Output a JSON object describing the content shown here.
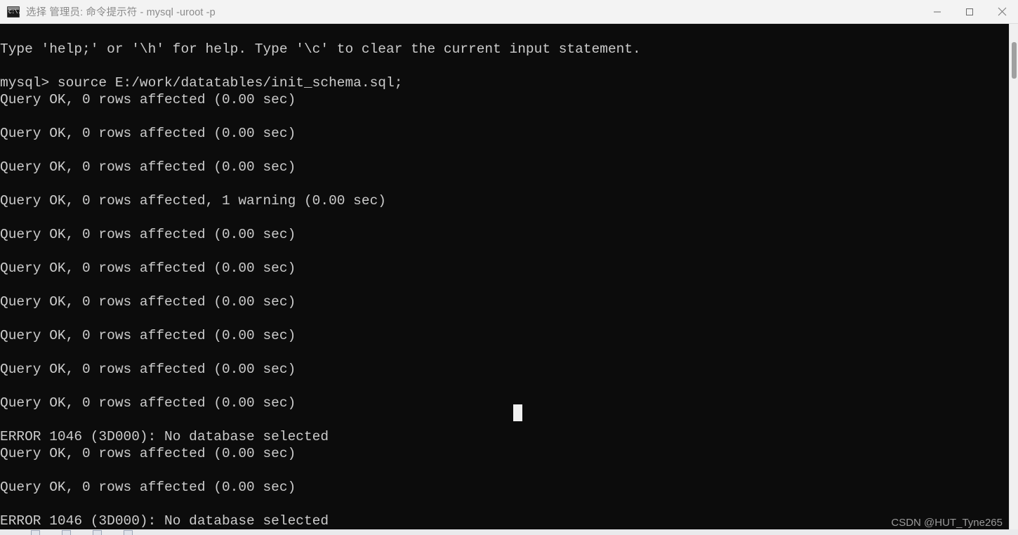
{
  "window": {
    "title": "选择 管理员: 命令提示符 - mysql  -uroot -p",
    "icon_label": "C:\\.",
    "icon_name": "command-prompt-icon",
    "colors": {
      "titlebar_bg": "#f3f3f3",
      "titlebar_text": "#8b8b8b",
      "terminal_bg": "#0c0c0c",
      "terminal_text": "#cccccc",
      "scrollbar_track": "#f0f0f0",
      "scrollbar_thumb": "#a0a0a0",
      "close_hover": "#e81123"
    },
    "controls": {
      "minimize": "—",
      "maximize": "□",
      "close": "✕"
    }
  },
  "terminal": {
    "lines": [
      "",
      "Type 'help;' or '\\h' for help. Type '\\c' to clear the current input statement.",
      "",
      "mysql> source E:/work/datatables/init_schema.sql;",
      "Query OK, 0 rows affected (0.00 sec)",
      "",
      "Query OK, 0 rows affected (0.00 sec)",
      "",
      "Query OK, 0 rows affected (0.00 sec)",
      "",
      "Query OK, 0 rows affected, 1 warning (0.00 sec)",
      "",
      "Query OK, 0 rows affected (0.00 sec)",
      "",
      "Query OK, 0 rows affected (0.00 sec)",
      "",
      "Query OK, 0 rows affected (0.00 sec)",
      "",
      "Query OK, 0 rows affected (0.00 sec)",
      "",
      "Query OK, 0 rows affected (0.00 sec)",
      "",
      "Query OK, 0 rows affected (0.00 sec)",
      "",
      "ERROR 1046 (3D000): No database selected",
      "Query OK, 0 rows affected (0.00 sec)",
      "",
      "Query OK, 0 rows affected (0.00 sec)",
      "",
      "ERROR 1046 (3D000): No database selected"
    ]
  },
  "watermark": {
    "text": "CSDN @HUT_Tyne265"
  }
}
